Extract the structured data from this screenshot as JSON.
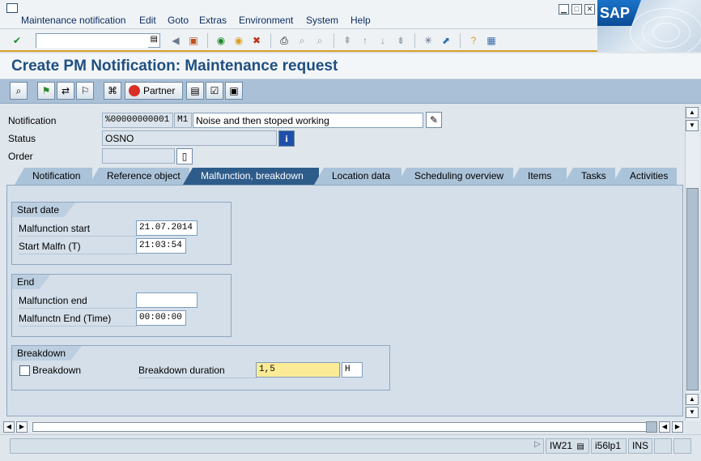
{
  "menu": {
    "items": [
      {
        "label": "Maintenance notification"
      },
      {
        "label": "Edit"
      },
      {
        "label": "Goto"
      },
      {
        "label": "Extras"
      },
      {
        "label": "Environment"
      },
      {
        "label": "System"
      },
      {
        "label": "Help"
      }
    ]
  },
  "window_controls": {
    "minimize": "▁",
    "maximize": "□",
    "close": "✕"
  },
  "brand": {
    "logo": "SAP",
    "color": "#0b4c96"
  },
  "command_field": {
    "value": ""
  },
  "page": {
    "title": "Create PM Notification: Maintenance request"
  },
  "app_toolbar": {
    "partner_label": "Partner"
  },
  "header": {
    "notification": {
      "label": "Notification",
      "number": "%00000000001",
      "type": "M1",
      "description": "Noise and then stoped working"
    },
    "status": {
      "label": "Status",
      "value": "OSNO"
    },
    "order": {
      "label": "Order",
      "value": ""
    }
  },
  "tabs": [
    {
      "label": "Notification"
    },
    {
      "label": "Reference object"
    },
    {
      "label": "Malfunction, breakdown"
    },
    {
      "label": "Location data"
    },
    {
      "label": "Scheduling overview"
    },
    {
      "label": "Items"
    },
    {
      "label": "Tasks"
    },
    {
      "label": "Activities"
    }
  ],
  "start_date": {
    "title": "Start date",
    "malfunction_start_label": "Malfunction start",
    "malfunction_start": "21.07.2014",
    "start_time_label": "Start Malfn (T)",
    "start_time": "21:03:54"
  },
  "end": {
    "title": "End",
    "malfunction_end_label": "Malfunction end",
    "malfunction_end": "",
    "end_time_label": "Malfunctn End (Time)",
    "end_time": "00:00:00"
  },
  "breakdown": {
    "title": "Breakdown",
    "checkbox_label": "Breakdown",
    "checked": false,
    "duration_label": "Breakdown duration",
    "duration": "1,5",
    "unit": "H"
  },
  "status_bar": {
    "message": "",
    "transaction": "IW21",
    "server": "i56lp1",
    "mode": "INS"
  },
  "colors": {
    "accent": "#d79f24",
    "title": "#1f4f80",
    "active_tab": "#2e5c8a",
    "highlight_field": "#fbeb96"
  }
}
